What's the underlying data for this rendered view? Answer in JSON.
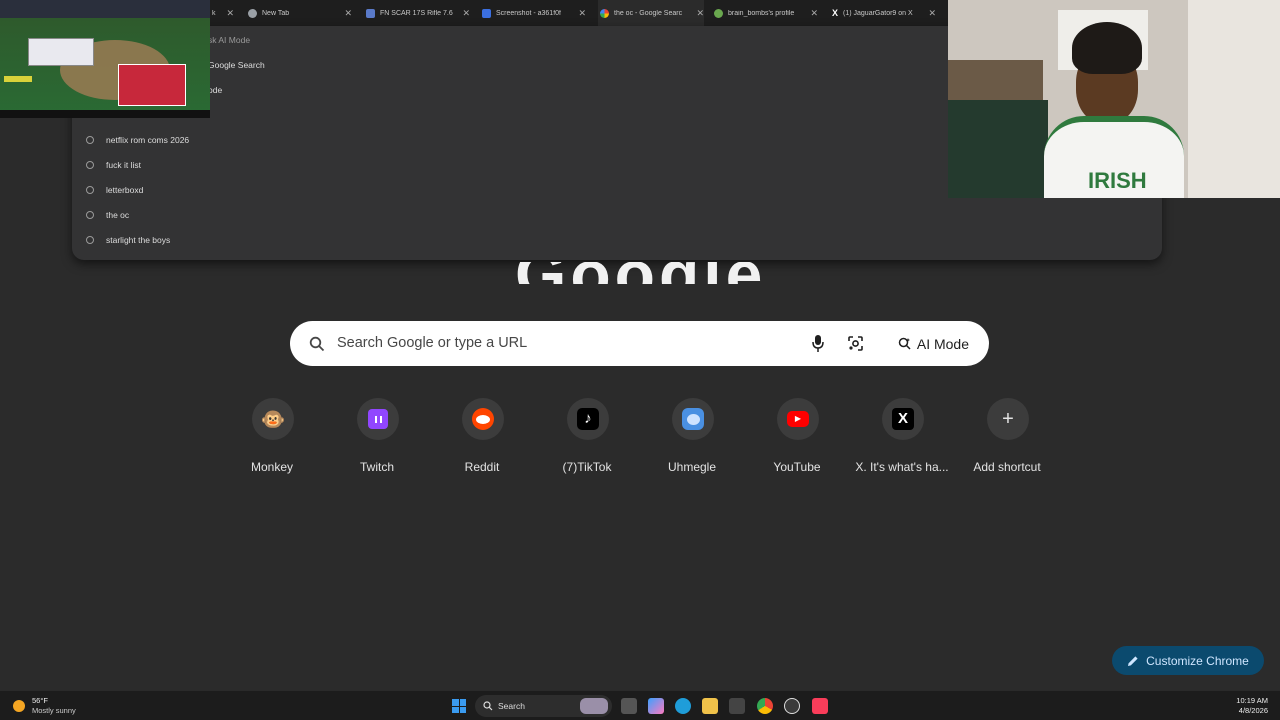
{
  "tabs": [
    {
      "title": "New Tab",
      "favicon": "globe-icon",
      "color": "#9aa0a6"
    },
    {
      "title": "FN SCAR 17S Rifle 7.6",
      "favicon": "gun-site-icon",
      "color": "#5a7ac9"
    },
    {
      "title": "Screenshot - a361f0f",
      "favicon": "screenshot-icon",
      "color": "#3b6fe0"
    },
    {
      "title": "the oc - Google Searc",
      "favicon": "google-icon",
      "color": "#4285f4"
    },
    {
      "title": "brain_bombs's profile",
      "favicon": "profile-icon",
      "color": "#6aa84f"
    },
    {
      "title": "(1) JaguarGator9 on X",
      "favicon": "x-icon",
      "color": "#ffffff"
    }
  ],
  "dropdown": {
    "partial_items": [
      "sk AI Mode",
      "Google Search",
      "ode"
    ],
    "history": [
      "netflix rom coms 2026",
      "fuck it list",
      "letterboxd",
      "the oc",
      "starlight the boys"
    ]
  },
  "logo_text": "Google",
  "search": {
    "placeholder": "Search Google or type a URL",
    "ai_mode_label": "AI Mode"
  },
  "shortcuts": [
    {
      "label": "Monkey",
      "icon": "monkey-icon",
      "bg": "#3c3c3c",
      "glyph": "🐵"
    },
    {
      "label": "Twitch",
      "icon": "twitch-icon",
      "bg": "#9146ff",
      "glyph": "▮"
    },
    {
      "label": "Reddit",
      "icon": "reddit-icon",
      "bg": "#ff4500",
      "glyph": "●"
    },
    {
      "label": "(7)TikTok",
      "icon": "tiktok-icon",
      "bg": "#000000",
      "glyph": "♪"
    },
    {
      "label": "Uhmegle",
      "icon": "uhmegle-icon",
      "bg": "#4a90e2",
      "glyph": "●"
    },
    {
      "label": "YouTube",
      "icon": "youtube-icon",
      "bg": "#ff0000",
      "glyph": "▶"
    },
    {
      "label": "X. It's what's ha...",
      "icon": "x-icon",
      "bg": "#000000",
      "glyph": "𝕏"
    },
    {
      "label": "Add shortcut",
      "icon": "plus-icon",
      "bg": "#3c3c3c",
      "glyph": "+"
    }
  ],
  "customize_label": "Customize Chrome",
  "taskbar": {
    "weather_temp": "56°F",
    "weather_desc": "Mostly sunny",
    "search_label": "Search",
    "time": "10:19 AM",
    "date": "4/8/2026"
  },
  "webcam_shirt_text": "IRISH"
}
